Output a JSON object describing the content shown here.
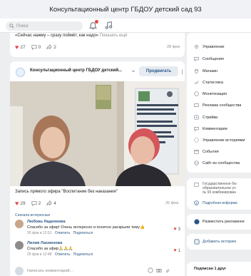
{
  "window": {
    "title": "Консультационный центр ГБДОУ детский сад 93"
  },
  "toolbar": {
    "search_placeholder": "Поиск"
  },
  "feed_top": {
    "quote": "«Сейчас нажму – сразу поймёт, как надо»",
    "show_more": "Показать ещё",
    "likes": "27",
    "comments": "0",
    "reposts": "2",
    "date": "28 фев"
  },
  "post": {
    "author": "Консультационный центр ГБДОУ детский...",
    "promote_label": "Продвигать",
    "caption": "Запись прямого эфира \"Воспитание без наказания\"",
    "likes": "29",
    "comments": "2",
    "reposts": "4",
    "date": "26 фев",
    "show_interesting": "Сначала интересные"
  },
  "comments": [
    {
      "name": "Любовь Надеинова",
      "text": "Спасибо за эфир! Очень интересно и понятно раскрыли тему👍",
      "date": "26 фев в 12:51",
      "reply": "Ответить",
      "share": "Поделиться",
      "likes": "3"
    },
    {
      "name": "Лилия Лахменова",
      "text": "Спасибо за эфир🙏🙏🙏",
      "date": "26 фев в 12:48",
      "reply": "Ответить",
      "share": "Поделиться",
      "likes": "1"
    }
  ],
  "write_comment": {
    "placeholder": "Написать комментарий..."
  },
  "sidebar": {
    "items": [
      {
        "label": "Управление",
        "icon": "gear-icon"
      },
      {
        "label": "Сообщения",
        "icon": "message-icon"
      },
      {
        "label": "Магазин",
        "icon": "shop-icon"
      },
      {
        "label": "Статистика",
        "icon": "stats-icon"
      },
      {
        "label": "Монетизация",
        "icon": "coin-icon"
      },
      {
        "label": "Реклама сообщества",
        "icon": "ad-icon"
      },
      {
        "label": "Стрийки",
        "icon": "play-icon"
      },
      {
        "label": "Комментарии",
        "icon": "comment-icon"
      },
      {
        "label": "Управление историями",
        "icon": "stories-icon"
      },
      {
        "label": "События",
        "icon": "calendar-icon"
      },
      {
        "label": "Сайт из сообщества",
        "icon": "globe-icon"
      }
    ]
  },
  "org_block": {
    "text1": "Государственное бю",
    "text2": "образовательное уч",
    "text3": "№ 93 комбинирован",
    "more_link": "Подробная информа"
  },
  "ad_block": {
    "label": "Разместить рекламное"
  },
  "story_block": {
    "label": "Добавить историю"
  },
  "friends_block": {
    "label": "Подписан 1 друг"
  },
  "colors": {
    "accent": "#2a5885",
    "like": "#e64646",
    "background": "#edeef0"
  }
}
